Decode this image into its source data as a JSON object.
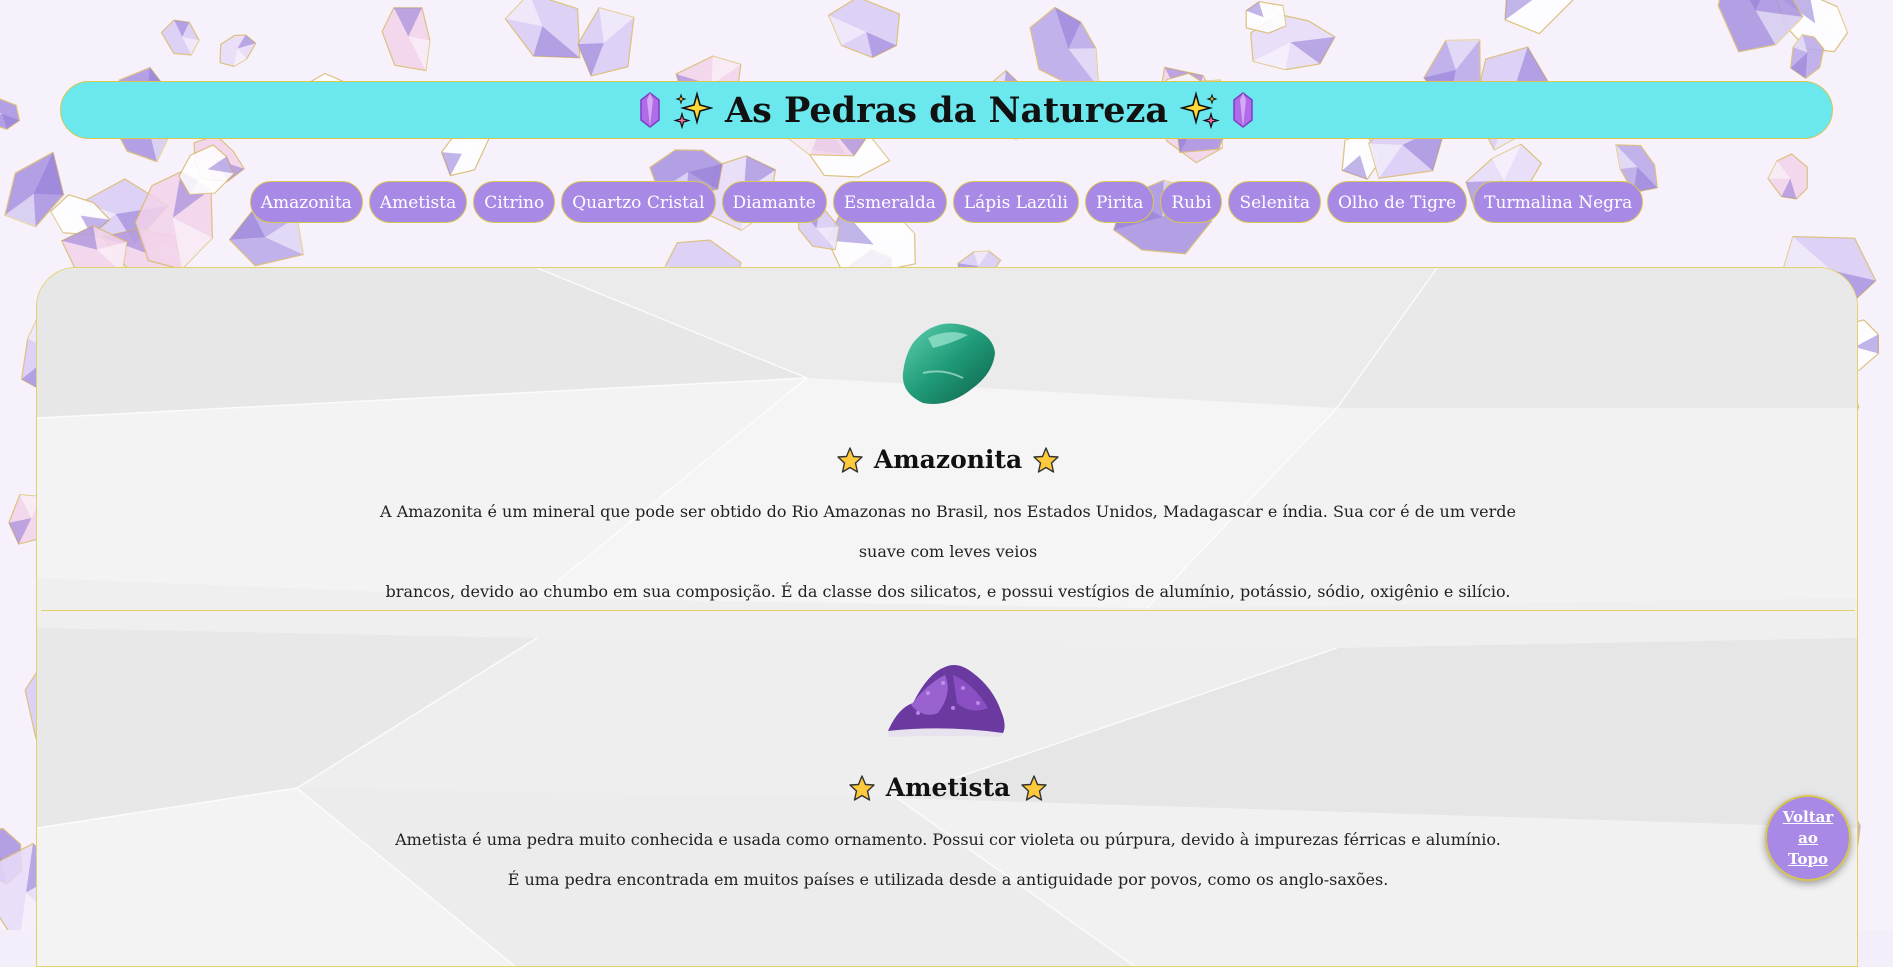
{
  "header": {
    "title": "As Pedras da Natureza",
    "icons": [
      "gem-icon",
      "sparkles-icon",
      "sparkles-icon",
      "gem-icon"
    ]
  },
  "nav": {
    "items": [
      "Amazonita",
      "Ametista",
      "Citrino",
      "Quartzo Cristal",
      "Diamante",
      "Esmeralda",
      "Lápis Lazúli",
      "Pirita",
      "Rubi",
      "Selenita",
      "Olho de Tigre",
      "Turmalina Negra"
    ]
  },
  "stones": [
    {
      "name": "Amazonita",
      "description_lines": [
        "A Amazonita é um mineral que pode ser obtido do Rio Amazonas no Brasil, nos Estados Unidos, Madagascar e índia. Sua cor é de um verde suave com leves veios",
        "brancos, devido ao chumbo em sua composição. É da classe dos silicatos, e possui vestígios de alumínio, potássio, sódio, oxigênio e silício."
      ]
    },
    {
      "name": "Ametista",
      "description_lines": [
        "Ametista é uma pedra muito conhecida e usada como ornamento. Possui cor violeta ou púrpura, devido à impurezas férricas e alumínio.",
        "É uma pedra encontrada em muitos países e utilizada desde a antiguidade por povos, como os anglo-saxões."
      ]
    }
  ],
  "back_to_top": {
    "label_lines": [
      "Voltar",
      "ao",
      "Topo"
    ]
  },
  "colors": {
    "header_bg": "#6be8ee",
    "nav_button_bg": "#a88ae6",
    "border_gold": "#d7c650",
    "crystal_purple": "#9a86d8",
    "crystal_pink": "#f2cde6"
  }
}
